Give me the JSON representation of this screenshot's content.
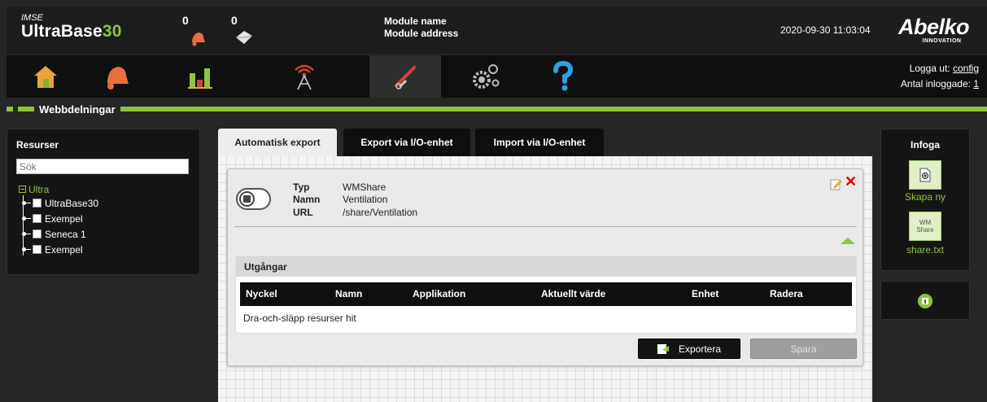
{
  "header": {
    "brand_small": "IMSE",
    "brand_name": "UltraBase",
    "brand_number": "30",
    "alarm_count": "0",
    "message_count": "0",
    "module_name": "Module name",
    "module_address": "Module address",
    "datetime": "2020-09-30 11:03:04",
    "logo_name": "Abelko",
    "logo_sub": "INNOVATION"
  },
  "nav": {
    "items": [
      "home-icon",
      "bell-icon",
      "chart-icon",
      "antenna-icon",
      "tools-icon",
      "gears-icon",
      "help-icon"
    ],
    "active_index": 4,
    "login_prefix": "Logga ut: ",
    "login_user": "config",
    "logged_in_prefix": "Antal inloggade: ",
    "logged_in_count": "1"
  },
  "section": {
    "title": "Webbdelningar"
  },
  "resources": {
    "title": "Resurser",
    "search_placeholder": "Sök",
    "root": "Ultra",
    "items": [
      "UltraBase30",
      "Exempel",
      "Seneca 1",
      "Exempel"
    ]
  },
  "tabs": [
    {
      "label": "Automatisk export",
      "active": true
    },
    {
      "label": "Export via I/O-enhet",
      "active": false
    },
    {
      "label": "Import via I/O-enhet",
      "active": false
    }
  ],
  "share": {
    "type_label": "Typ",
    "type_value": "WMShare",
    "name_label": "Namn",
    "name_value": "Ventilation",
    "url_label": "URL",
    "url_value": "/share/Ventilation",
    "outputs_title": "Utgångar",
    "columns": [
      "Nyckel",
      "Namn",
      "Applikation",
      "Aktuellt värde",
      "Enhet",
      "Radera"
    ],
    "drop_hint": "Dra-och-släpp resurser hit",
    "export_label": "Exportera",
    "save_label": "Spara"
  },
  "insert": {
    "title": "Infoga",
    "create_label": "Skapa ny",
    "file_icon_text_1": "WM",
    "file_icon_text_2": "Share",
    "file_label": "share.txt"
  },
  "colors": {
    "accent": "#8fc43c",
    "danger": "#dd0000"
  }
}
